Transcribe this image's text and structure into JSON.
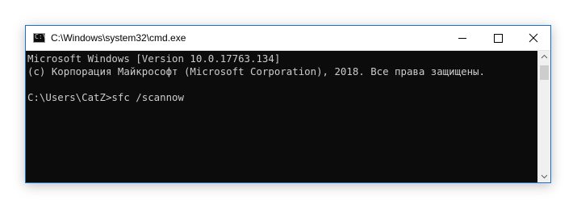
{
  "window": {
    "title": "C:\\Windows\\system32\\cmd.exe",
    "app_icon": "cmd-icon",
    "controls": {
      "minimize_icon": "minimize-icon",
      "maximize_icon": "maximize-icon",
      "close_icon": "close-icon"
    }
  },
  "console": {
    "lines": [
      "Microsoft Windows [Version 10.0.17763.134]",
      "(c) Корпорация Майкрософт (Microsoft Corporation), 2018. Все права защищены.",
      "",
      "C:\\Users\\CatZ>sfc /scannow"
    ],
    "text_color": "#cccccc",
    "background_color": "#0c0c0c"
  },
  "scrollbar": {
    "up_icon": "scroll-up-arrow-icon",
    "down_icon": "scroll-down-arrow-icon"
  },
  "colors": {
    "window_border": "#1a6fd0",
    "titlebar": "#ffffff"
  }
}
